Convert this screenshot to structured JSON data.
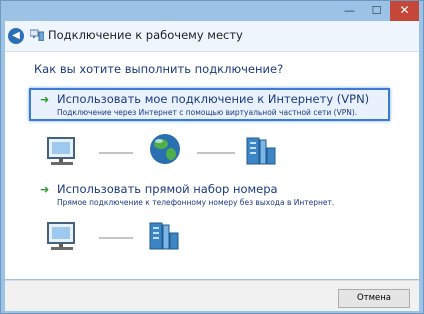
{
  "window": {
    "title": "Подключение к рабочему месту",
    "controls": {
      "minimize": "—",
      "maximize": "☐",
      "close": "✕"
    }
  },
  "main": {
    "question": "Как вы хотите выполнить подключение?",
    "options": [
      {
        "title": "Использовать мое подключение к Интернету (VPN)",
        "description": "Подключение через Интернет с помощью виртуальной частной сети (VPN).",
        "selected": true
      },
      {
        "title": "Использовать прямой набор номера",
        "description": "Прямое подключение к телефонному номеру без выхода в Интернет.",
        "selected": false
      }
    ],
    "diagrams": [
      {
        "icons": [
          "computer-icon",
          "globe-icon",
          "corporate-network-icon"
        ]
      },
      {
        "icons": [
          "computer-icon",
          "corporate-network-icon"
        ]
      }
    ]
  },
  "footer": {
    "cancel_label": "Отмена"
  },
  "colors": {
    "frame": "#9cc3e6",
    "link_text": "#1b3a80",
    "selection_border": "#3b7bd0",
    "selection_fill": "#e9f2fc",
    "arrow_green": "#2f9a2f",
    "close_button": "#c4473a"
  }
}
